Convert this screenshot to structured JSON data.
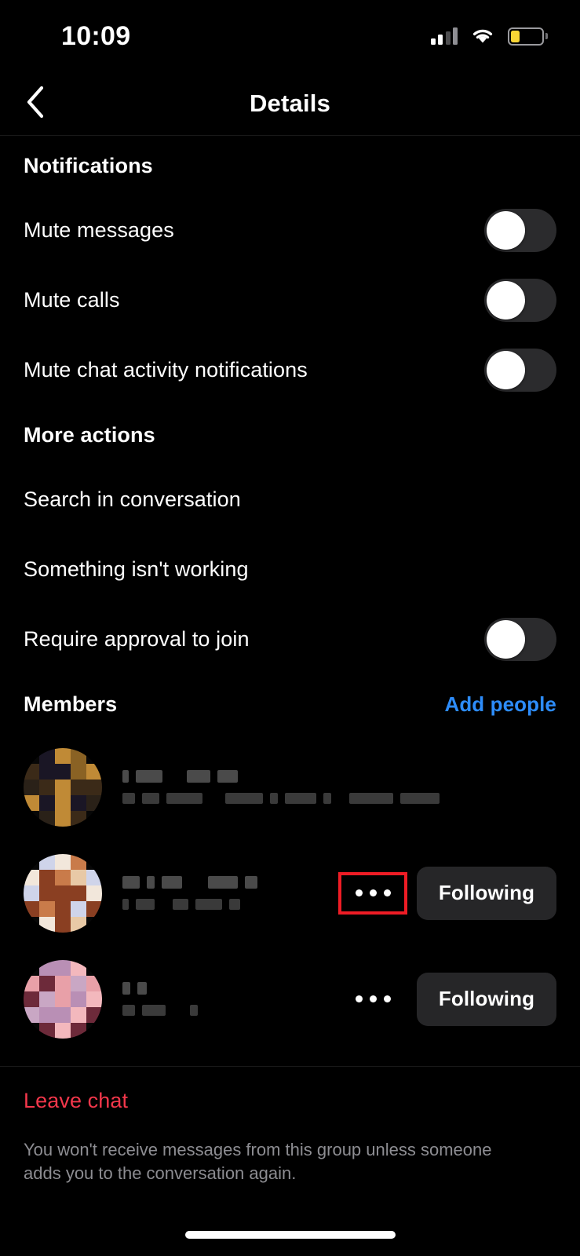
{
  "status_bar": {
    "time": "10:09",
    "signal_icon": "cellular-signal-icon",
    "wifi_icon": "wifi-icon",
    "battery_icon": "battery-low-icon",
    "battery_color": "#f8d535"
  },
  "nav": {
    "back_icon": "chevron-left-icon",
    "title": "Details"
  },
  "sections": {
    "notifications": {
      "heading": "Notifications",
      "rows": [
        {
          "label": "Mute messages",
          "toggle": "off"
        },
        {
          "label": "Mute calls",
          "toggle": "off"
        },
        {
          "label": "Mute chat activity notifications",
          "toggle": "off"
        }
      ]
    },
    "more_actions": {
      "heading": "More actions",
      "rows": [
        {
          "label": "Search in conversation",
          "toggle": null
        },
        {
          "label": "Something isn't working",
          "toggle": null
        },
        {
          "label": "Require approval to join",
          "toggle": "off"
        }
      ]
    },
    "members": {
      "heading": "Members",
      "add_people_label": "Add people",
      "add_people_color": "#2d8cfa",
      "rows": [
        {
          "name": "[redacted]",
          "subtitle": "[redacted]",
          "avatar_colors": [
            "#1a1625",
            "#3b2a18",
            "#8a6224",
            "#c08a36",
            "#2a2118"
          ],
          "dots_icon": "more-options-icon",
          "highlighted": false,
          "follow_label": null
        },
        {
          "name": "[redacted]",
          "subtitle": "[redacted]",
          "avatar_colors": [
            "#f2e7db",
            "#c97b4a",
            "#8a3f22",
            "#cfd4ea",
            "#e8c9a6"
          ],
          "dots_icon": "more-options-icon",
          "highlighted": true,
          "follow_label": "Following"
        },
        {
          "name": "[redacted]",
          "subtitle": "[redacted]",
          "avatar_colors": [
            "#c9a7c4",
            "#b98fb5",
            "#e8a0a8",
            "#f3b8bd",
            "#6d2a3a"
          ],
          "dots_icon": "more-options-icon",
          "highlighted": false,
          "follow_label": "Following"
        }
      ]
    }
  },
  "footer": {
    "leave_label": "Leave chat",
    "leave_color": "#f3374b",
    "note": "You won't receive messages from this group unless someone adds you to the conversation again."
  },
  "highlight": {
    "color": "#ee1c25",
    "target": "more-options-icon-member-2"
  }
}
